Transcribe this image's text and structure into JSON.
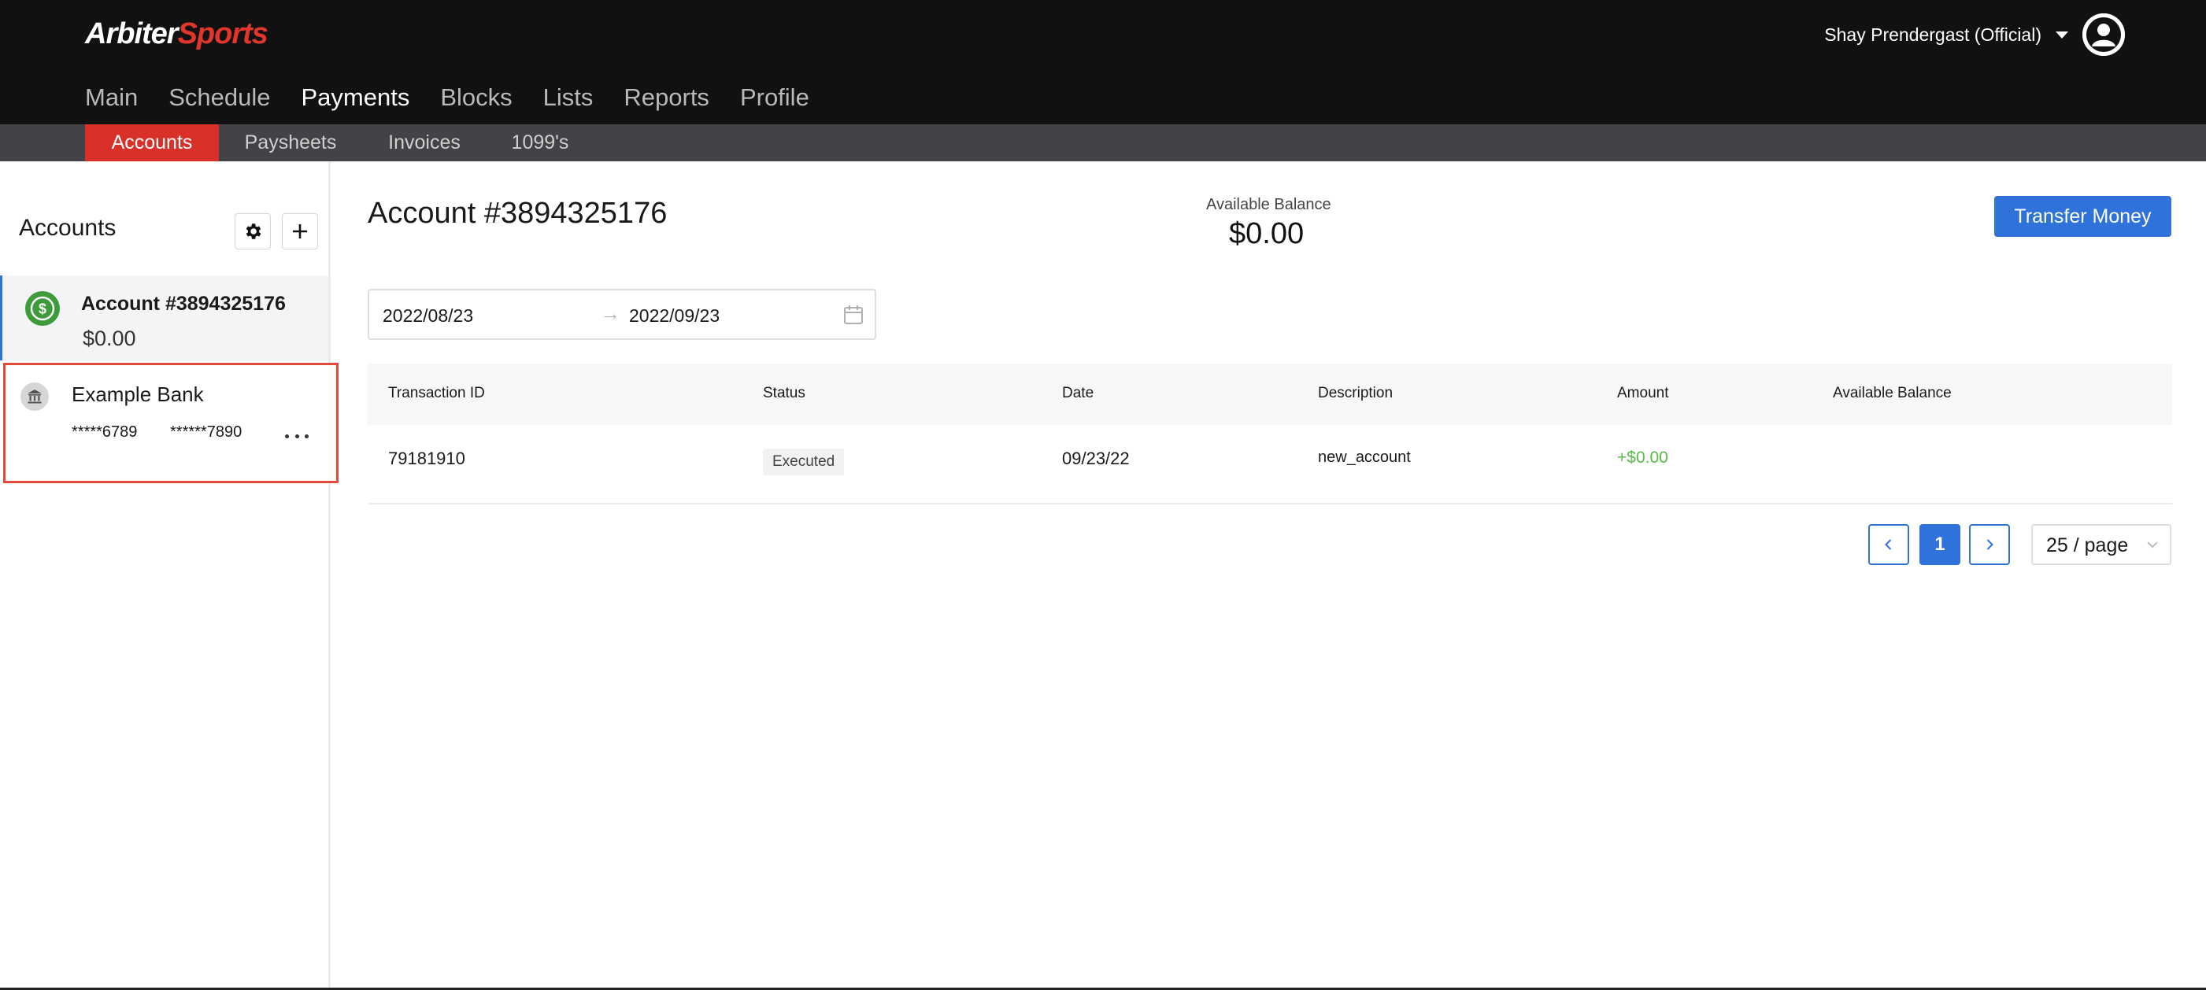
{
  "header": {
    "logo_part1": "Arbiter",
    "logo_part2": "Sports",
    "user_name": "Shay Prendergast (Official)",
    "nav": [
      "Main",
      "Schedule",
      "Payments",
      "Blocks",
      "Lists",
      "Reports",
      "Profile"
    ],
    "active_nav": "Payments"
  },
  "subnav": {
    "items": [
      "Accounts",
      "Paysheets",
      "Invoices",
      "1099's"
    ],
    "active": "Accounts"
  },
  "sidebar": {
    "title": "Accounts",
    "account": {
      "name": "Account #3894325176",
      "balance": "$0.00"
    },
    "bank": {
      "name": "Example Bank",
      "masked_1": "*****6789",
      "masked_2": "******7890"
    }
  },
  "main": {
    "title": "Account #3894325176",
    "available_balance_label": "Available Balance",
    "available_balance_value": "$0.00",
    "transfer_button": "Transfer Money",
    "date_range": {
      "start": "2022/08/23",
      "end": "2022/09/23",
      "separator": "→"
    },
    "table": {
      "columns": [
        "Transaction ID",
        "Status",
        "Date",
        "Description",
        "Amount",
        "Available Balance"
      ],
      "rows": [
        {
          "transaction_id": "79181910",
          "status": "Executed",
          "date": "09/23/22",
          "description": "new_account",
          "amount": "+$0.00",
          "available_balance": ""
        }
      ]
    },
    "pagination": {
      "current_page": "1",
      "page_size": "25 / page"
    }
  },
  "colors": {
    "header_bg": "#111111",
    "subnav_bg": "#434347",
    "accent_red": "#d9302a",
    "primary_blue": "#2f72da",
    "positive_green": "#5ab94b",
    "account_icon_green": "#3e9b39"
  },
  "icons": [
    "caret-down-icon",
    "user-avatar-icon",
    "gear-icon",
    "plus-icon",
    "dollar-icon",
    "bank-icon",
    "more-icon",
    "arrow-right-icon",
    "calendar-icon",
    "chevron-left-icon",
    "chevron-right-icon",
    "chevron-down-icon"
  ]
}
